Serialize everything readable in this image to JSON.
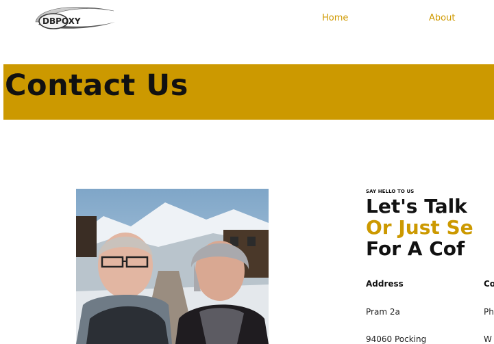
{
  "header": {
    "logo_text": "DBPOXY",
    "nav": [
      {
        "label": "Home"
      },
      {
        "label": "About"
      }
    ]
  },
  "banner": {
    "title": "Contact Us"
  },
  "contact": {
    "eyebrow": "SAY HELLO TO US",
    "heading_line1": "Let's Talk",
    "heading_line2": "Or Just Se",
    "heading_line3": "For A Cof",
    "address_header": "Address",
    "contact_header": "Co",
    "address_lines": [
      "Pram 2a",
      "94060 Pocking"
    ],
    "contact_lines": [
      "Ph",
      "W"
    ]
  },
  "colors": {
    "accent": "#cc9900",
    "nav_link": "#cf9900",
    "text": "#111111",
    "background": "#ffffff"
  },
  "icons": {
    "logo": "dbpoxy-logo"
  }
}
